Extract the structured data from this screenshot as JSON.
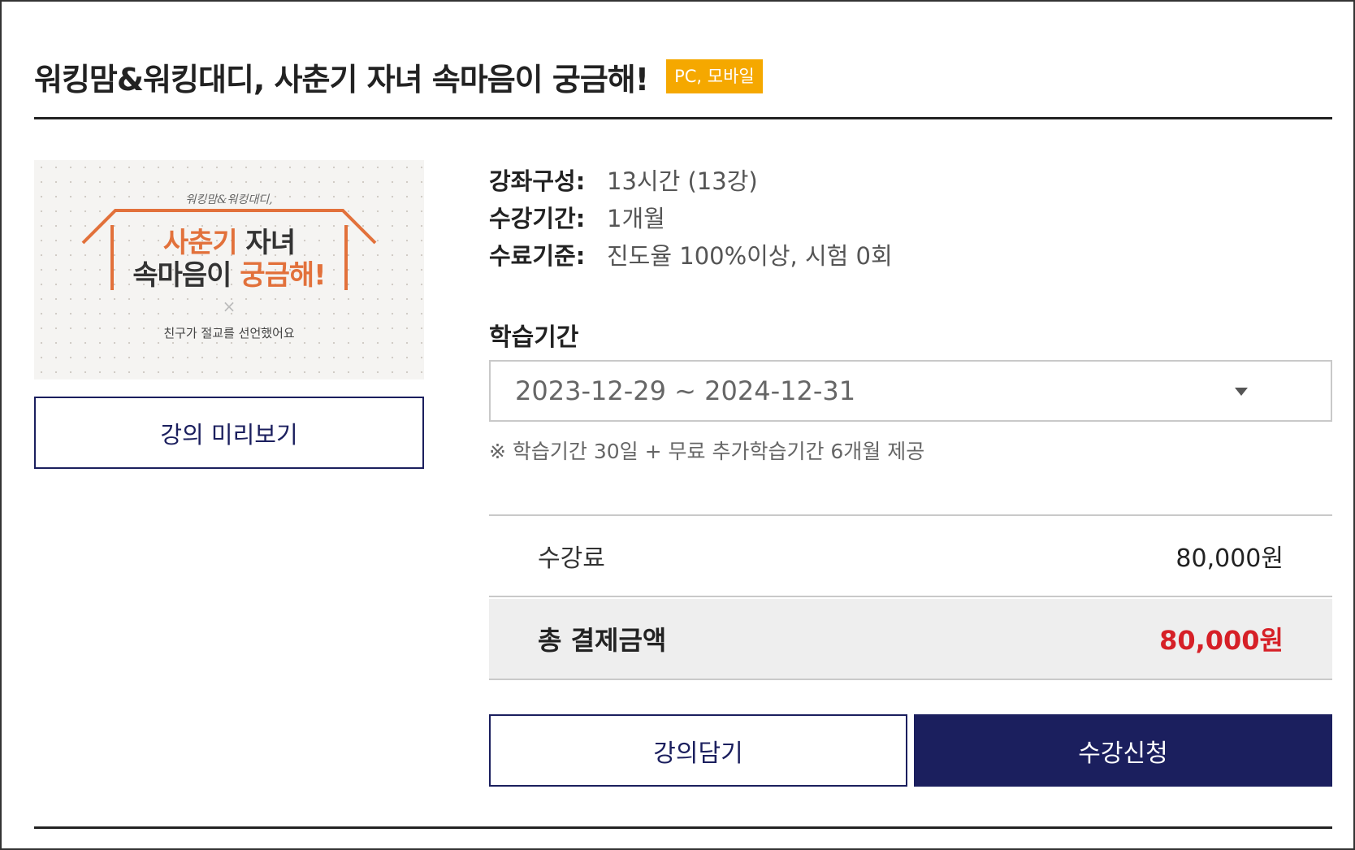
{
  "header": {
    "title": "워킹맘&워킹대디, 사춘기 자녀 속마음이 궁금해!",
    "badge": "PC, 모바일"
  },
  "thumbnail": {
    "small_text": "워킹맘&워킹대디,",
    "line1_part1": "사춘기",
    "line1_part2": " 자녀",
    "line2_part1": "속마음이 ",
    "line2_part2": "궁금해!",
    "x_mark": "×",
    "subtitle": "친구가 절교를 선언했어요"
  },
  "preview_button": "강의 미리보기",
  "info": [
    {
      "label": "강좌구성:",
      "value": "13시간 (13강)"
    },
    {
      "label": "수강기간:",
      "value": "1개월"
    },
    {
      "label": "수료기준:",
      "value": "진도율 100%이상, 시험 0회"
    }
  ],
  "period": {
    "heading": "학습기간",
    "selected": "2023-12-29 ~ 2024-12-31",
    "note": "※ 학습기간 30일 + 무료 추가학습기간 6개월 제공"
  },
  "pricing": {
    "fee_label": "수강료",
    "fee_value": "80,000원",
    "total_label": "총 결제금액",
    "total_value": "80,000원"
  },
  "actions": {
    "cart": "강의담기",
    "enroll": "수강신청"
  },
  "colors": {
    "navy": "#1b1f5e",
    "badge": "#f5a800",
    "accent_orange": "#e2713b",
    "total_red": "#d62027"
  }
}
